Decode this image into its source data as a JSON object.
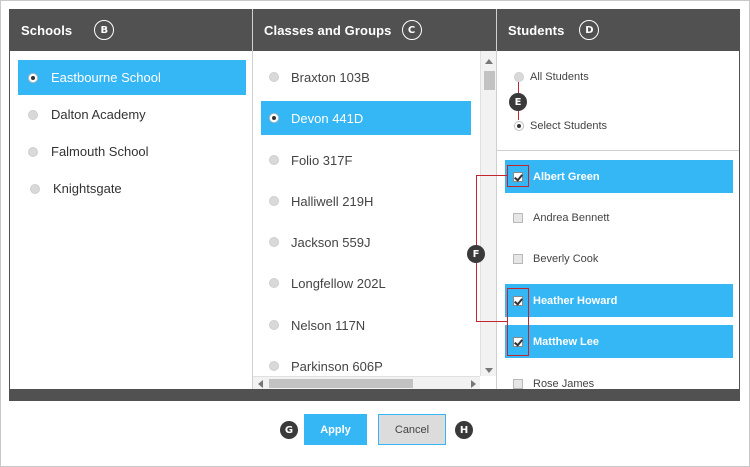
{
  "columns": {
    "schools": {
      "title": "Schools",
      "callout": "B"
    },
    "classes": {
      "title": "Classes and Groups",
      "callout": "C"
    },
    "students": {
      "title": "Students",
      "callout": "D"
    }
  },
  "schools": [
    {
      "label": "Eastbourne School",
      "selected": true
    },
    {
      "label": "Dalton Academy",
      "selected": false
    },
    {
      "label": "Falmouth School",
      "selected": false
    },
    {
      "label": "Knightsgate",
      "selected": false
    }
  ],
  "classes": [
    {
      "label": "Braxton 103B",
      "selected": false
    },
    {
      "label": "Devon 441D",
      "selected": true
    },
    {
      "label": "Folio 317F",
      "selected": false
    },
    {
      "label": "Halliwell 219H",
      "selected": false
    },
    {
      "label": "Jackson 559J",
      "selected": false
    },
    {
      "label": "Longfellow 202L",
      "selected": false
    },
    {
      "label": "Nelson 117N",
      "selected": false
    },
    {
      "label": "Parkinson 606P",
      "selected": false
    }
  ],
  "student_mode": {
    "all_label": "All Students",
    "select_label": "Select Students",
    "selected": "select"
  },
  "students": [
    {
      "label": "Albert Green",
      "checked": true
    },
    {
      "label": "Andrea Bennett",
      "checked": false
    },
    {
      "label": "Beverly Cook",
      "checked": false
    },
    {
      "label": "Heather Howard",
      "checked": true
    },
    {
      "label": "Matthew Lee",
      "checked": true
    },
    {
      "label": "Rose James",
      "checked": false
    }
  ],
  "annotations": {
    "e": "E",
    "f": "F",
    "g": "G",
    "h": "H"
  },
  "buttons": {
    "apply": "Apply",
    "cancel": "Cancel"
  },
  "colors": {
    "header": "#515151",
    "accent": "#35b6f5",
    "annotation": "#c0262d"
  }
}
